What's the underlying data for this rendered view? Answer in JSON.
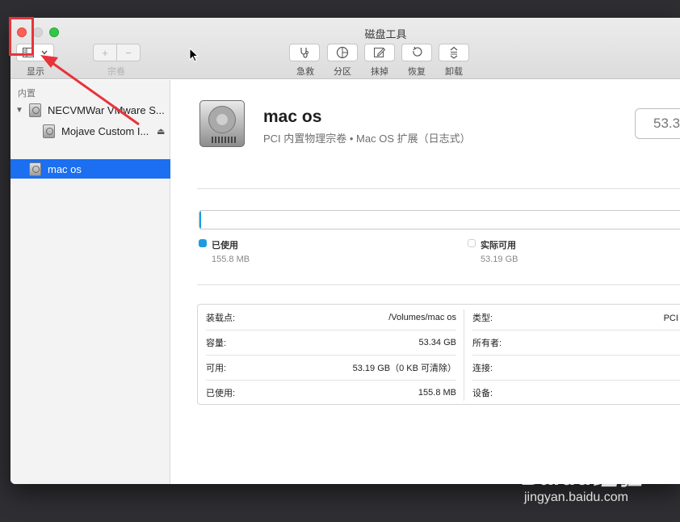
{
  "window": {
    "title": "磁盘工具"
  },
  "toolbar": {
    "view_label": "显示",
    "volume_label": "宗卷",
    "add_symbol": "+",
    "remove_symbol": "−",
    "first_aid_label": "急救",
    "partition_label": "分区",
    "erase_label": "抹掉",
    "restore_label": "恢复",
    "unmount_label": "卸载"
  },
  "sidebar": {
    "section_title": "内置",
    "items": [
      {
        "label": "NECVMWar VMware S...",
        "expanded": true,
        "icon": "hard-disk-icon"
      },
      {
        "label": "Mojave Custom I...",
        "icon": "hard-disk-icon",
        "eject": "⏏"
      },
      {
        "label": "mac os",
        "selected": true,
        "icon": "hard-disk-icon"
      }
    ]
  },
  "volume": {
    "name": "mac os",
    "description": "PCI 内置物理宗卷 • Mac OS 扩展（日志式）",
    "capacity_display": "53.3"
  },
  "usage": {
    "used_fraction": 0.003,
    "used_label": "已使用",
    "used_value": "155.8 MB",
    "used_color": "#1b9be0",
    "free_label": "实际可用",
    "free_value": "53.19 GB",
    "free_color": "#ffffff"
  },
  "info": {
    "left": [
      {
        "key": "装载点:",
        "value": "/Volumes/mac os"
      },
      {
        "key": "容量:",
        "value": "53.34 GB"
      },
      {
        "key": "可用:",
        "value": "53.19 GB（0 KB 可清除）"
      },
      {
        "key": "已使用:",
        "value": "155.8 MB"
      }
    ],
    "right": [
      {
        "key": "类型:",
        "value": "PCI 内置"
      },
      {
        "key": "所有者:",
        "value": ""
      },
      {
        "key": "连接:",
        "value": ""
      },
      {
        "key": "设备:",
        "value": ""
      }
    ]
  },
  "watermark": {
    "brand": "Baidu经验",
    "url": "jingyan.baidu.com"
  },
  "colors": {
    "accent": "#1b6ff0",
    "annotation": "#e8333a"
  }
}
